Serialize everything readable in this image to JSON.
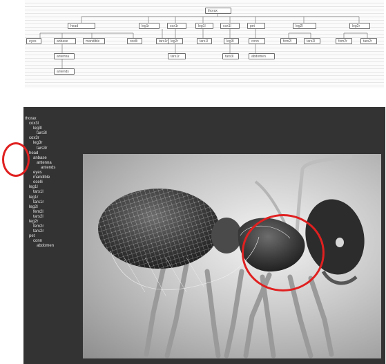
{
  "tree": {
    "nodes": {
      "thorax": "thorax",
      "head": "head",
      "leg1r": "leg1r",
      "cox1r": "cox1r",
      "leg1l": "leg1l",
      "cox1l": "cox1l",
      "pet": "pet",
      "leg2l": "leg2l",
      "leg2r": "leg2r",
      "eyes": "eyes",
      "anbase": "anbase",
      "mandible": "mandible",
      "ocelli": "ocelli",
      "tars1r_a": "tars1r",
      "leg2r_b": "leg2r",
      "tars1l": "tars1l",
      "leg3l": "leg3l",
      "conn": "conn",
      "fem2l": "fem2l",
      "tars2l": "tars2l",
      "fem2r": "fem2r",
      "tars2r": "tars2r",
      "antenna": "antenna",
      "tars1r_b": "tars1r",
      "tars3l": "tars3l",
      "abdomen": "abdomen",
      "antends": "antends"
    }
  },
  "outliner": {
    "items": [
      "thorax",
      "cox3l",
      "leg3l",
      "tars3l",
      "cox3r",
      "leg3r",
      "tars3r",
      "head",
      "anbase",
      "antenna",
      "antends",
      "eyes",
      "mandible",
      "ocelli",
      "leg1l",
      "tars1l",
      "leg1r",
      "tars1r",
      "leg2l",
      "fem2l",
      "tars2l",
      "leg2r",
      "fem2r",
      "tars2r",
      "pet",
      "conn",
      "abdomen"
    ]
  },
  "colors": {
    "highlight": "#e02020",
    "viewport_bg": "#333333",
    "outliner_text": "#e4e4e4"
  }
}
